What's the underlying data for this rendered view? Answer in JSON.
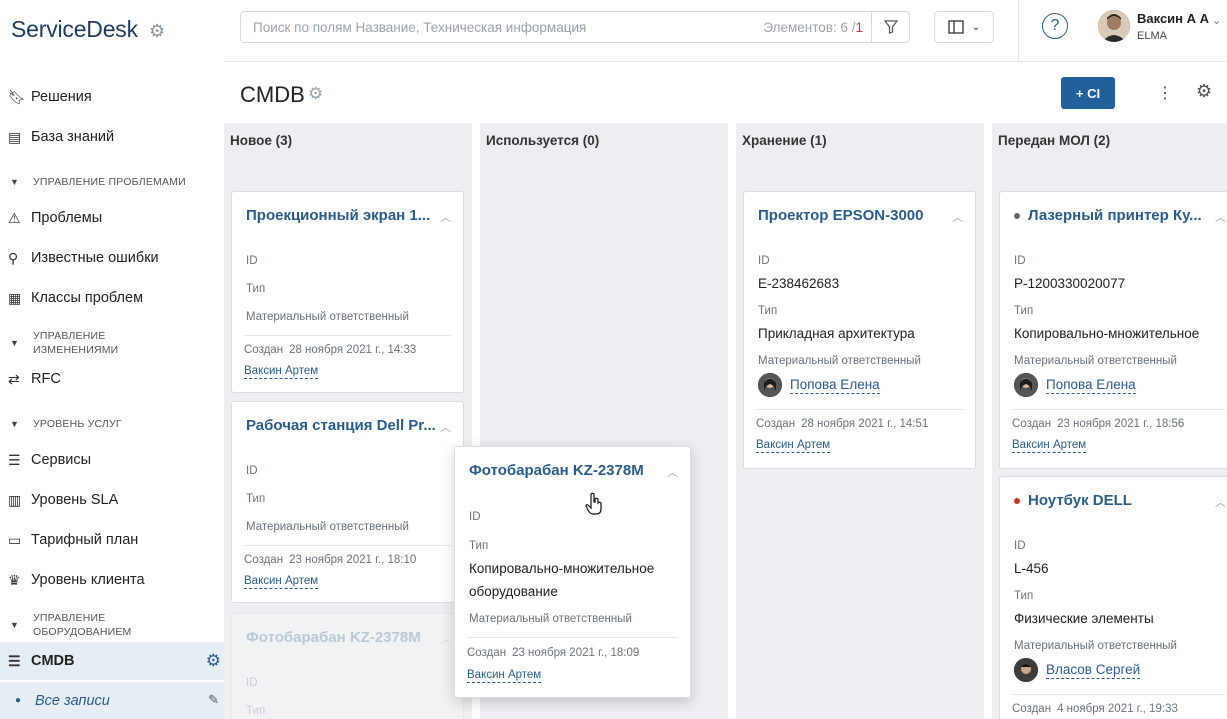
{
  "sidebar": {
    "logo": "ServiceDesk",
    "items": [
      {
        "icon": "bookmark-icon",
        "label": "Решения"
      },
      {
        "icon": "book-icon",
        "label": "База знаний"
      },
      {
        "section": "Управление проблемами"
      },
      {
        "icon": "warning-icon",
        "label": "Проблемы"
      },
      {
        "icon": "bug-icon",
        "label": "Известные ошибки"
      },
      {
        "icon": "grid-icon",
        "label": "Классы проблем"
      },
      {
        "section": "Управление изменениями"
      },
      {
        "icon": "swap-icon",
        "label": "RFC"
      },
      {
        "section": "Уровень услуг"
      },
      {
        "icon": "list-icon",
        "label": "Сервисы"
      },
      {
        "icon": "chart-icon",
        "label": "Уровень SLA"
      },
      {
        "icon": "card-icon",
        "label": "Тарифный план"
      },
      {
        "icon": "crown-icon",
        "label": "Уровень клиента"
      },
      {
        "section": "Управление оборудованием"
      },
      {
        "icon": "list-icon",
        "label": "CMDB"
      }
    ],
    "sub_item": "Все записи"
  },
  "topbar": {
    "search_placeholder": "Поиск по полям Название, Техническая информация",
    "count_label": "Элементов: 6 /",
    "count_selected": "1",
    "user_name": "Ваксин А А",
    "user_org": "ELMA"
  },
  "header": {
    "title": "CMDB",
    "add_button": "+ CI"
  },
  "labels": {
    "id": "ID",
    "type": "Тип",
    "owner": "Материальный ответственный",
    "created": "Создан"
  },
  "columns": [
    {
      "title": "Новое (3)"
    },
    {
      "title": "Используется (0)"
    },
    {
      "title": "Хранение (1)"
    },
    {
      "title": "Передан МОЛ (2)"
    }
  ],
  "cards": {
    "c1": {
      "title": "Проекционный экран 1...",
      "created": "28 ноября 2021 г., 14:33",
      "author": "Ваксин Артем"
    },
    "c2": {
      "title": "Рабочая станция Dell Pr...",
      "created": "23 ноября 2021 г., 18:10",
      "author": "Ваксин Артем"
    },
    "c3": {
      "title": "Фотобарабан KZ-2378M"
    },
    "c4": {
      "title": "Проектор EPSON-3000",
      "id": "E-238462683",
      "type": "Прикладная архитектура",
      "owner": "Попова Елена",
      "created": "28 ноября 2021 г., 14:51",
      "author": "Ваксин Артем"
    },
    "c5": {
      "title": "Лазерный принтер Ку...",
      "id": "P-1200330020077",
      "type": "Копировально-множительное",
      "owner": "Попова Елена",
      "created": "23 ноября 2021 г., 18:56",
      "author": "Ваксин Артем",
      "dot_color": "#666666"
    },
    "c6": {
      "title": "Ноутбук DELL",
      "id": "L-456",
      "type": "Физические элементы",
      "owner": "Власов Сергей",
      "created": "4 ноября 2021 г., 19:33",
      "dot_color": "#c0392b"
    },
    "drag": {
      "title": "Фотобарабан KZ-2378M",
      "type_line1": "Копировально-множительное",
      "type_line2": "оборудование",
      "created": "23 ноября 2021 г., 18:09",
      "author": "Ваксин Артем"
    }
  }
}
